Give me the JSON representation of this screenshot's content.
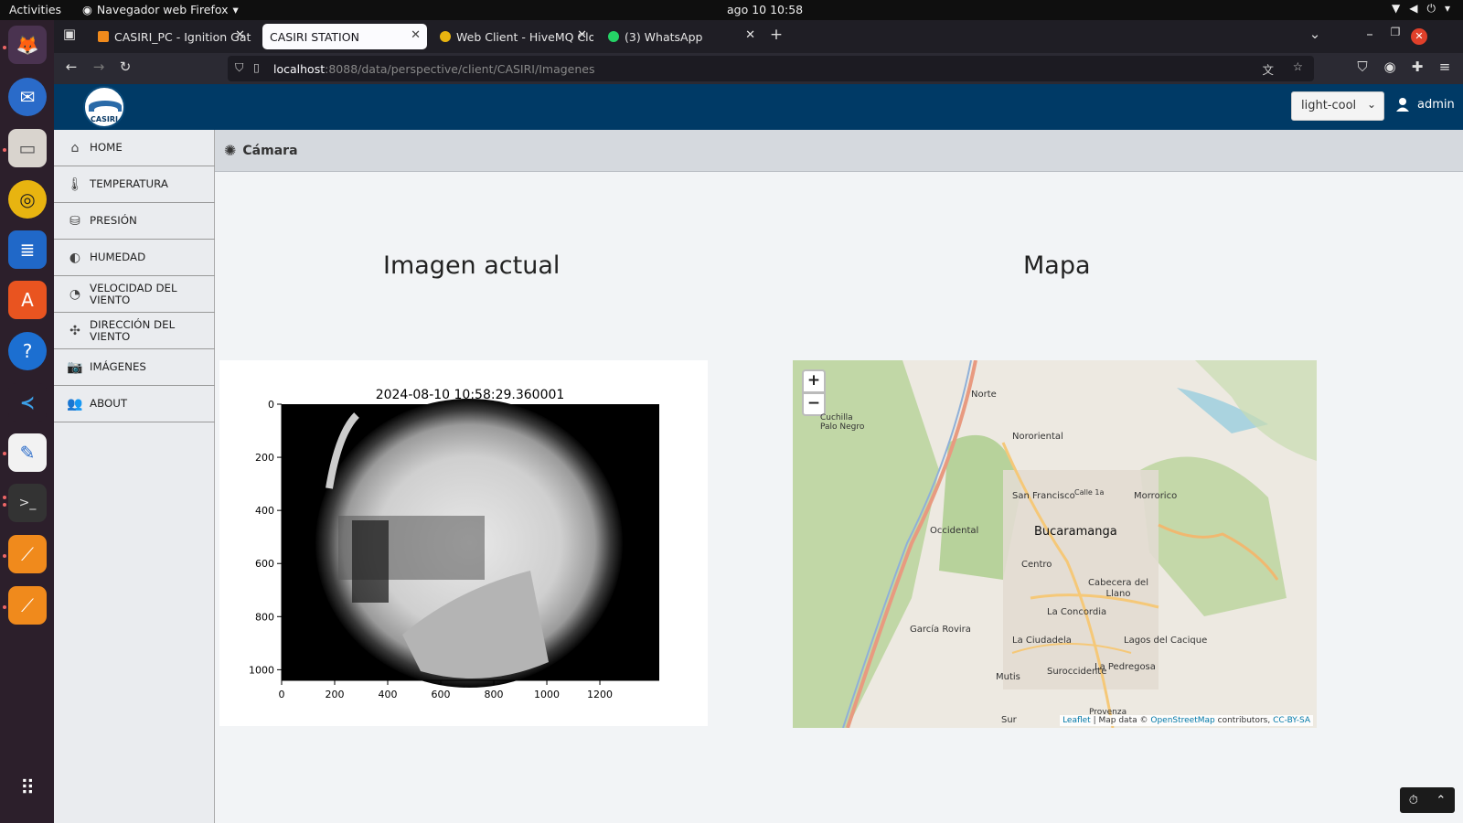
{
  "system": {
    "activities": "Activities",
    "app_name": "Navegador web Firefox",
    "clock": "ago 10  10:58"
  },
  "browser": {
    "tabs": [
      {
        "label": "CASIRI_PC - Ignition Gate",
        "active": false
      },
      {
        "label": "CASIRI STATION",
        "active": true
      },
      {
        "label": "Web Client - HiveMQ Clo",
        "active": false
      },
      {
        "label": "(3) WhatsApp",
        "active": false
      }
    ],
    "url_host": "localhost",
    "url_path": ":8088/data/perspective/client/CASIRI/Imagenes"
  },
  "app": {
    "logo_text": "CASIRI",
    "theme_value": "light-cool",
    "user": "admin",
    "sidebar": [
      {
        "label": "HOME",
        "icon": "home-icon"
      },
      {
        "label": "TEMPERATURA",
        "icon": "thermometer-icon"
      },
      {
        "label": "PRESIÓN",
        "icon": "cylinder-icon"
      },
      {
        "label": "HUMEDAD",
        "icon": "drop-icon"
      },
      {
        "label": "VELOCIDAD DEL VIENTO",
        "icon": "speedometer-icon"
      },
      {
        "label": "DIRECCIÓN DEL VIENTO",
        "icon": "fan-icon"
      },
      {
        "label": "IMÁGENES",
        "icon": "camera-icon"
      },
      {
        "label": "ABOUT",
        "icon": "people-icon"
      }
    ],
    "page_title": "Cámara",
    "left_title": "Imagen actual",
    "right_title": "Mapa"
  },
  "plot": {
    "title": "2024-08-10 10:58:29.360001",
    "x_ticks": [
      "0",
      "200",
      "400",
      "600",
      "800",
      "1000",
      "1200"
    ],
    "y_ticks": [
      "0",
      "200",
      "400",
      "600",
      "800",
      "1000"
    ]
  },
  "map": {
    "zoom_in": "+",
    "zoom_out": "−",
    "labels": [
      {
        "text": "Norte"
      },
      {
        "text": "Nororiental"
      },
      {
        "text": "Cuchilla Palo Negro"
      },
      {
        "text": "San Francisco"
      },
      {
        "text": "Morrorico"
      },
      {
        "text": "Occidental"
      },
      {
        "text": "Bucaramanga"
      },
      {
        "text": "Centro"
      },
      {
        "text": "Cabecera del Llano"
      },
      {
        "text": "La Concordia"
      },
      {
        "text": "García Rovira"
      },
      {
        "text": "La Ciudadela"
      },
      {
        "text": "Lagos del Cacique"
      },
      {
        "text": "Mutis"
      },
      {
        "text": "Suroccidente"
      },
      {
        "text": "La Pedregosa"
      },
      {
        "text": "Sur"
      },
      {
        "text": "Provenza"
      },
      {
        "text": "Calle 1a"
      }
    ],
    "attribution_leaflet": "Leaflet",
    "attribution_mid": "| Map data ©",
    "attribution_osm": "OpenStreetMap",
    "attribution_contrib": "contributors,",
    "attribution_cc": "CC-BY-SA"
  }
}
